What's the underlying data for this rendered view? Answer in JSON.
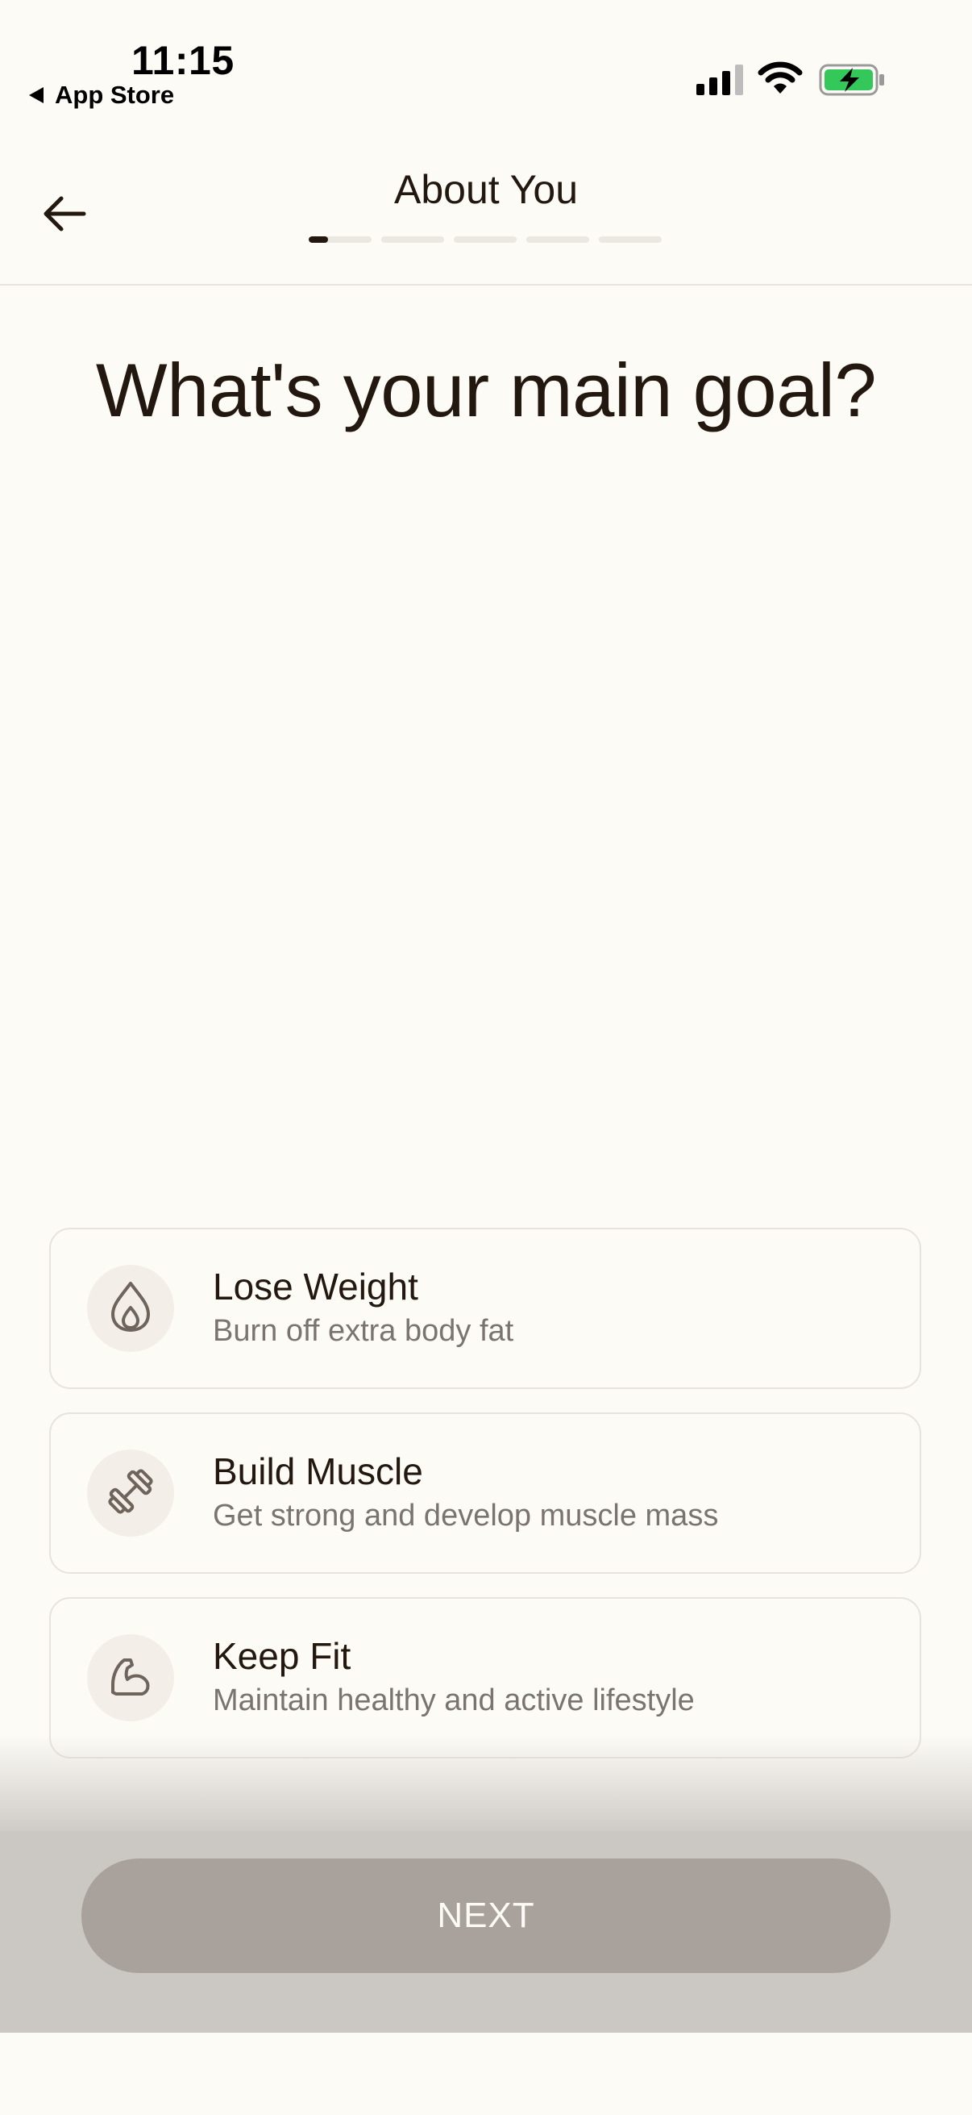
{
  "status_bar": {
    "time": "11:15",
    "back_app": "App Store",
    "battery_color": "#34c759"
  },
  "header": {
    "title": "About You",
    "progress": {
      "current_step": 1,
      "total_steps": 5
    }
  },
  "question": "What's your main goal?",
  "options": [
    {
      "title": "Lose Weight",
      "subtitle": "Burn off extra body fat",
      "icon": "flame-icon"
    },
    {
      "title": "Build Muscle",
      "subtitle": "Get strong and develop muscle mass",
      "icon": "dumbbell-icon"
    },
    {
      "title": "Keep Fit",
      "subtitle": "Maintain healthy and active lifestyle",
      "icon": "flexed-arm-icon"
    }
  ],
  "next_button": {
    "label": "NEXT"
  },
  "colors": {
    "background": "#fdfbf5",
    "text": "#22180f",
    "muted_text": "#7a7470",
    "button_disabled": "#a9a19c"
  }
}
